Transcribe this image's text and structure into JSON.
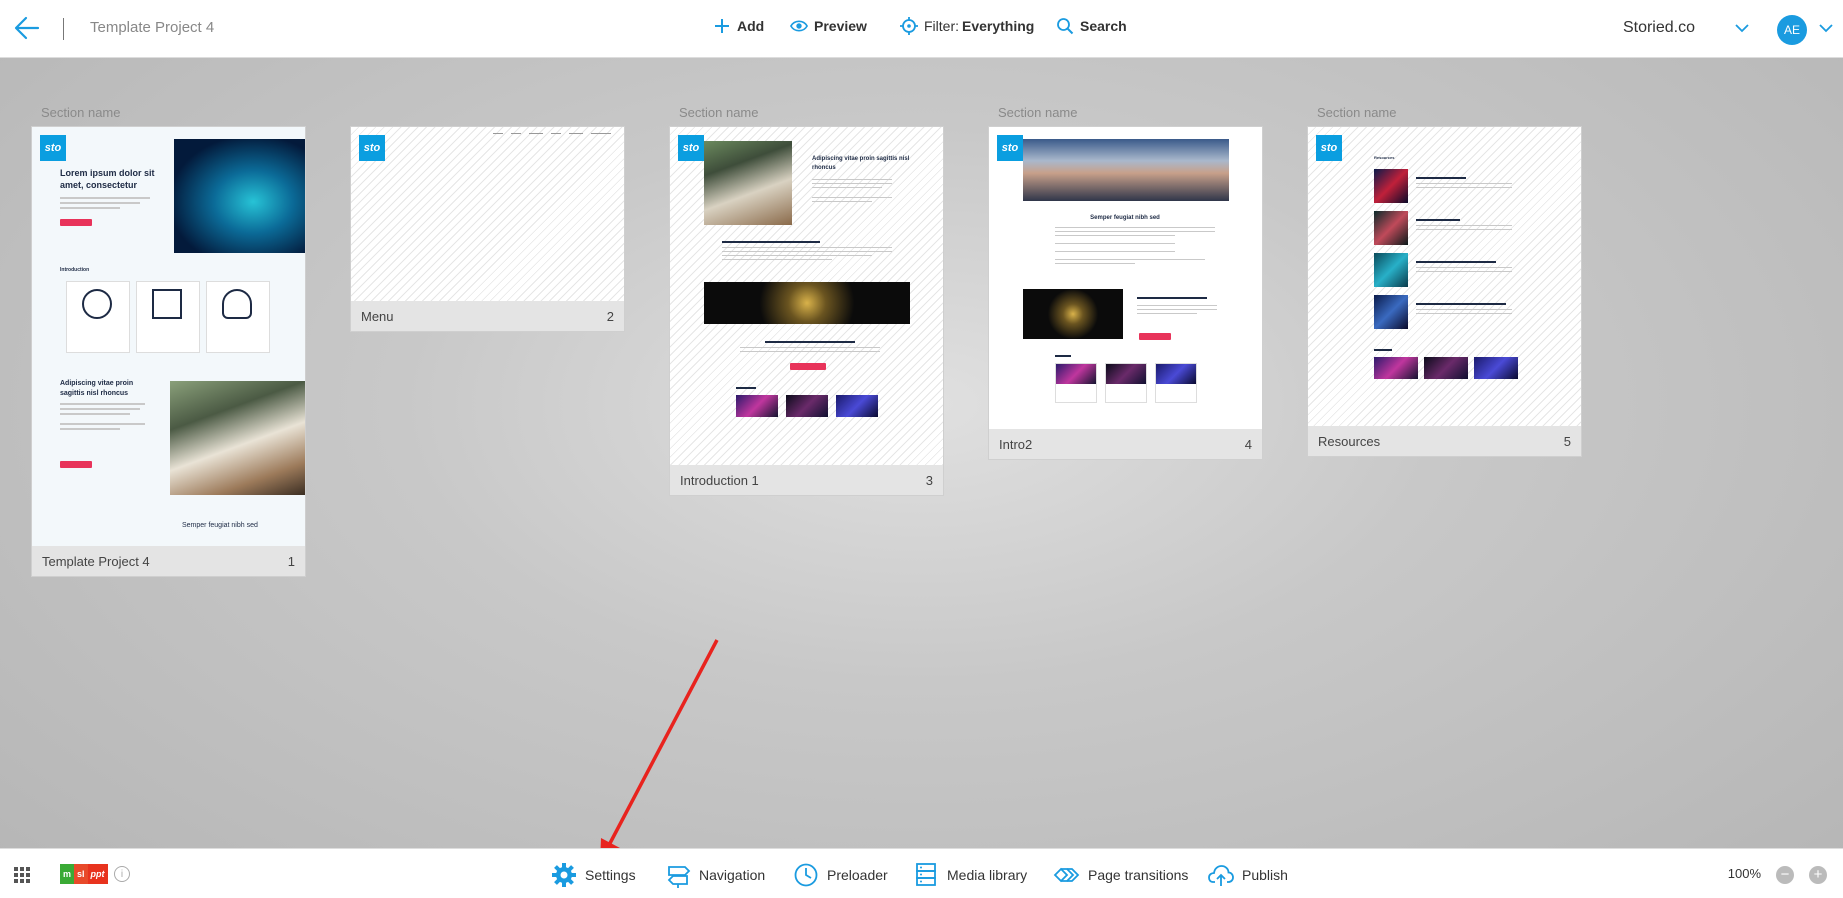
{
  "header": {
    "project_title": "Template Project 4",
    "actions": {
      "add": "Add",
      "preview": "Preview",
      "filter_prefix": "Filter:",
      "filter_value": "Everything",
      "search": "Search"
    },
    "org_name": "Storied.co",
    "avatar_initials": "AE"
  },
  "cards": [
    {
      "section_label": "Section name",
      "name": "Template Project 4",
      "number": "1",
      "badge": "sto",
      "preview_text": {
        "heading": "Lorem ipsum dolor sit amet, consectetur",
        "intro": "Introduction",
        "sub": "Adipiscing vitae proin sagittis nisl rhoncus",
        "footer": "Semper feugiat nibh sed"
      }
    },
    {
      "section_label": "",
      "name": "Menu",
      "number": "2",
      "badge": "sto"
    },
    {
      "section_label": "Section name",
      "name": "Introduction 1",
      "number": "3",
      "badge": "sto",
      "preview_text": {
        "heading": "Adipiscing vitae proin sagittis nisl rhoncus"
      }
    },
    {
      "section_label": "Section name",
      "name": "Intro2",
      "number": "4",
      "badge": "sto",
      "preview_text": {
        "heading": "Semper feugiat nibh sed"
      }
    },
    {
      "section_label": "Section name",
      "name": "Resources",
      "number": "5",
      "badge": "sto",
      "preview_text": {
        "heading": "Resources"
      }
    }
  ],
  "footer": {
    "lang_badge": [
      "m",
      "sl",
      "ppt"
    ],
    "items": {
      "settings": "Settings",
      "navigation": "Navigation",
      "preloader": "Preloader",
      "media_library": "Media library",
      "page_transitions": "Page transitions",
      "publish": "Publish"
    },
    "zoom": "100%",
    "zoom_out": "−",
    "zoom_in": "+"
  },
  "colors": {
    "accent": "#0a9ee0",
    "annotation_arrow": "#e8231e",
    "cta": "#e8335a"
  }
}
